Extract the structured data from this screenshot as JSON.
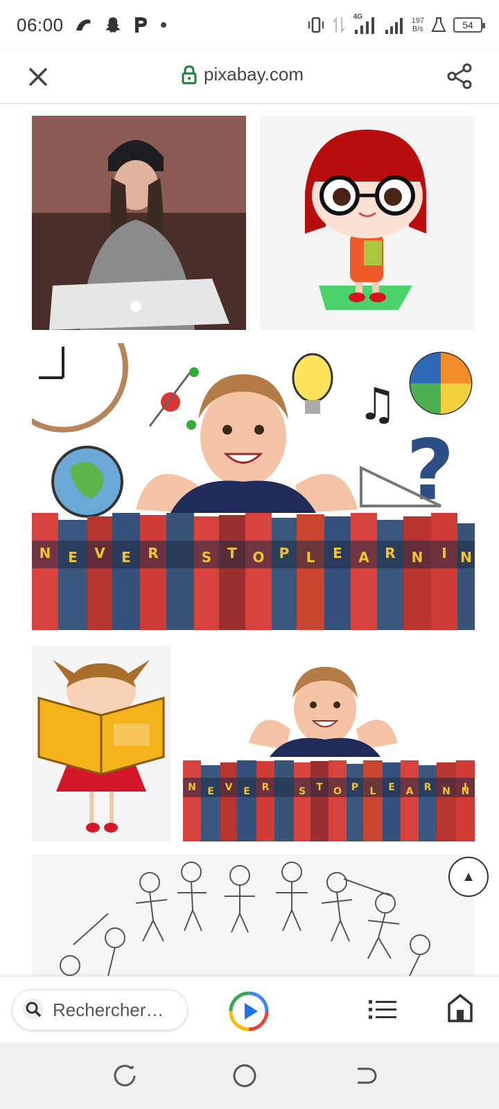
{
  "status_bar": {
    "time": "06:00",
    "left_icons": [
      "bird-icon",
      "snapchat-icon",
      "p-app-icon",
      "dot-icon"
    ],
    "network": "4G",
    "speed_value": "197",
    "speed_unit": "B/s",
    "battery": "54"
  },
  "browser": {
    "url": "pixabay.com",
    "close_icon": "close-icon",
    "lock_icon": "lock-icon",
    "share_icon": "share-icon",
    "lock_color": "#188038"
  },
  "gallery": {
    "books_text": "NEVER STOP LEARNING"
  },
  "toolbar": {
    "search_placeholder": "Rechercher…",
    "scroll_top_icon": "▲"
  }
}
